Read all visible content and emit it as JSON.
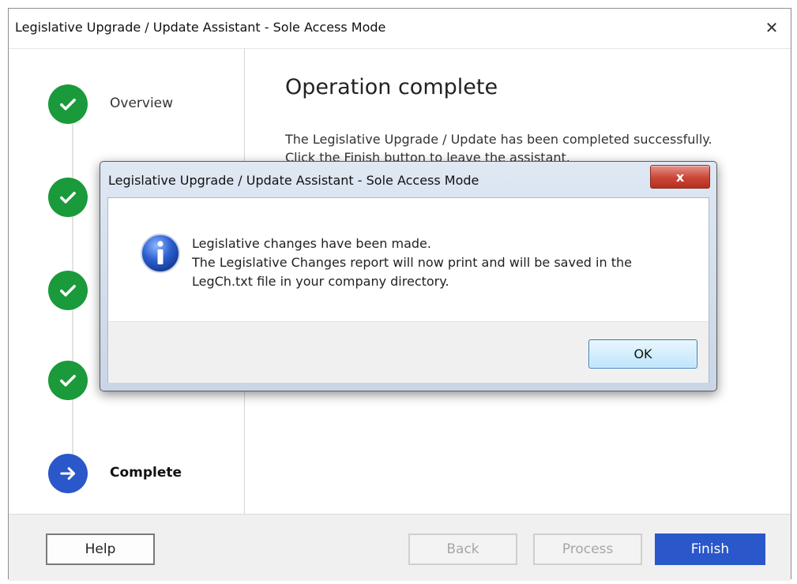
{
  "window": {
    "title": "Legislative Upgrade / Update Assistant - Sole Access Mode",
    "close_glyph": "✕"
  },
  "steps": [
    {
      "label": "Overview",
      "state": "done",
      "icon": "check-icon"
    },
    {
      "label": "",
      "state": "done",
      "icon": "check-icon"
    },
    {
      "label": "",
      "state": "done",
      "icon": "check-icon"
    },
    {
      "label": "",
      "state": "done",
      "icon": "check-icon"
    },
    {
      "label": "Complete",
      "state": "current",
      "icon": "arrow-right-icon"
    }
  ],
  "content": {
    "title": "Operation complete",
    "message_line1": "The Legislative Upgrade / Update has been completed successfully.",
    "message_line2": "Click the Finish button to leave the assistant."
  },
  "footer": {
    "help": "Help",
    "back": "Back",
    "process": "Process",
    "finish": "Finish"
  },
  "dialog": {
    "title": "Legislative Upgrade / Update Assistant - Sole Access Mode",
    "close_glyph": "x",
    "icon": "info-icon",
    "line1": "Legislative changes have been made.",
    "line2": "The Legislative Changes report will now print and will be saved in the",
    "line3": "LegCh.txt file in your company directory.",
    "ok": "OK"
  },
  "colors": {
    "done": "#1a9a3a",
    "current": "#2a57c9",
    "finish_button": "#2a57c9"
  }
}
